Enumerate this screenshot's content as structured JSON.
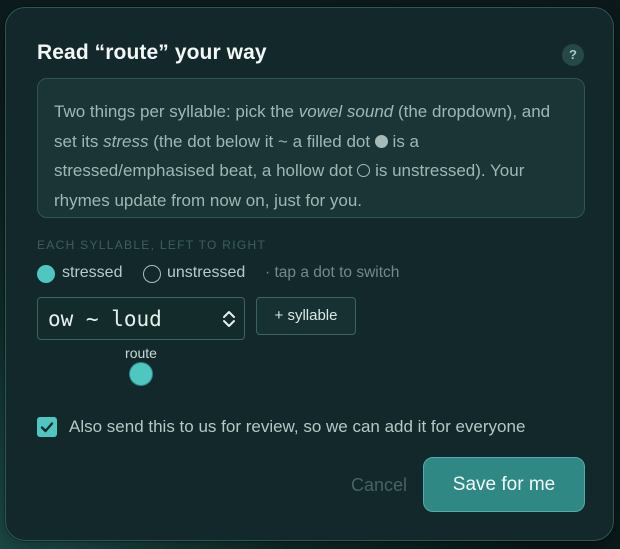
{
  "dialog": {
    "title": "Read “route” your way",
    "help_label": "?"
  },
  "info": {
    "part1": "Two things per syllable: pick the ",
    "em1": "vowel sound",
    "part2": " (the dropdown), and set its ",
    "em2": "stress",
    "part3": " (the dot below it ~ a filled dot ",
    "part4": " is a stressed/emphasised beat, a hollow dot ",
    "part5": " is unstressed). Your rhymes update from now on, just for you."
  },
  "syllables_section": {
    "label": "EACH SYLLABLE, LEFT TO RIGHT",
    "legend": {
      "stressed": "stressed",
      "unstressed": "unstressed",
      "hint": "· tap a dot to switch"
    },
    "syllables": [
      {
        "vowel": "ow ~ loud",
        "word": "route",
        "stress": "stressed"
      }
    ],
    "add_button": "+ syllable"
  },
  "review": {
    "checked": true,
    "label": "Also send this to us for review, so we can add it for everyone"
  },
  "actions": {
    "cancel": "Cancel",
    "save": "Save for me"
  },
  "colors": {
    "accent": "#4ec7c1",
    "primary_button": "#2f8883",
    "dialog_bg": "#13282a"
  }
}
